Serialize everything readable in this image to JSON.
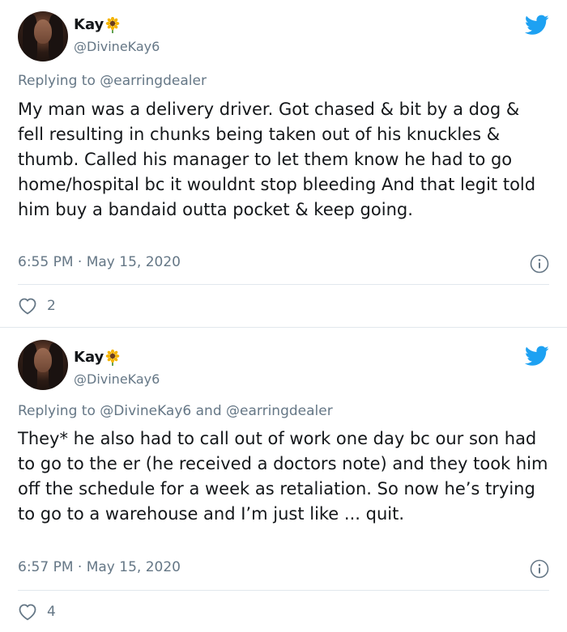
{
  "tweets": [
    {
      "author": {
        "display_name": "Kay",
        "emoji": "sunflower-icon",
        "handle": "@DivineKay6"
      },
      "reply_prefix": "Replying to",
      "reply_to": "@earringdealer",
      "text": "My man was a delivery driver. Got chased & bit by a dog & fell resulting in chunks being taken out of his knuckles & thumb. Called his manager to let them know he had to go home/hospital bc it wouldnt stop bleeding And that legit told him buy a bandaid outta pocket & keep going.",
      "timestamp": "6:55 PM · May 15, 2020",
      "likes": "2"
    },
    {
      "author": {
        "display_name": "Kay",
        "emoji": "sunflower-icon",
        "handle": "@DivineKay6"
      },
      "reply_prefix": "Replying to",
      "reply_to": "@DivineKay6 and @earringdealer",
      "text": "They* he also had to call out of work one day bc our son had to go to the er (he received a doctors note) and they took him off the schedule for a week as retaliation. So now he’s trying to go to a warehouse and I’m just like ... quit.",
      "timestamp": "6:57 PM · May 15, 2020",
      "likes": "4"
    }
  ],
  "colors": {
    "twitter_blue": "#1da1f2",
    "secondary_text": "#657786",
    "primary_text": "#14171a",
    "divider": "#e1e8ed"
  }
}
